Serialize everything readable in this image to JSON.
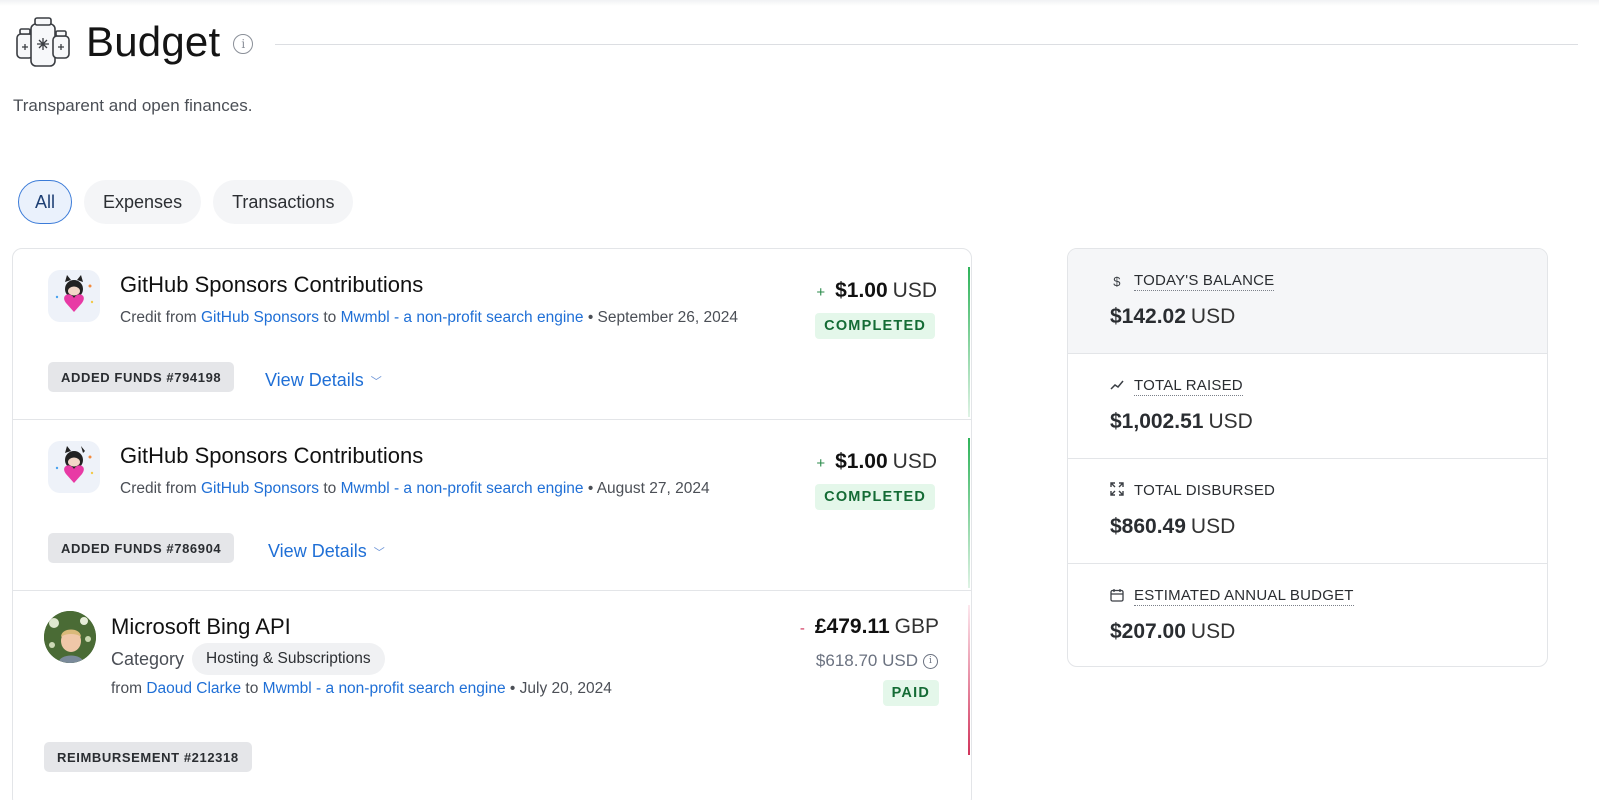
{
  "header": {
    "title": "Budget",
    "subtitle": "Transparent and open finances.",
    "info_glyph": "i"
  },
  "tabs": [
    {
      "label": "All",
      "active": true
    },
    {
      "label": "Expenses",
      "active": false
    },
    {
      "label": "Transactions",
      "active": false
    }
  ],
  "transactions": [
    {
      "title": "GitHub Sponsors Contributions",
      "prefix": "Credit from",
      "from": "GitHub Sponsors",
      "to_word": "to",
      "to": "Mwmbl - a non-profit search engine",
      "date": "• September 26, 2024",
      "sign": "+",
      "amount": "$1.00",
      "currency": "USD",
      "status": "COMPLETED",
      "badge": "ADDED FUNDS #794198",
      "details": "View Details",
      "icon": "github-sponsors-heart-icon"
    },
    {
      "title": "GitHub Sponsors Contributions",
      "prefix": "Credit from",
      "from": "GitHub Sponsors",
      "to_word": "to",
      "to": "Mwmbl - a non-profit search engine",
      "date": "• August 27, 2024",
      "sign": "+",
      "amount": "$1.00",
      "currency": "USD",
      "status": "COMPLETED",
      "badge": "ADDED FUNDS #786904",
      "details": "View Details",
      "icon": "github-sponsors-heart-icon"
    },
    {
      "title": "Microsoft Bing API",
      "category_label": "Category",
      "category": "Hosting & Subscriptions",
      "prefix": "from",
      "from": "Daoud Clarke",
      "to_word": "to",
      "to": "Mwmbl - a non-profit search engine",
      "date": "• July 20, 2024",
      "sign": "-",
      "amount": "£479.11",
      "currency": "GBP",
      "converted": "$618.70 USD",
      "status": "PAID",
      "badge": "REIMBURSEMENT #212318"
    }
  ],
  "summary": [
    {
      "label": "TODAY'S BALANCE",
      "amount": "$142.02",
      "currency": "USD",
      "icon": "dollar-icon"
    },
    {
      "label": "TOTAL RAISED",
      "amount": "$1,002.51",
      "currency": "USD",
      "icon": "trend-up-icon"
    },
    {
      "label": "TOTAL DISBURSED",
      "amount": "$860.49",
      "currency": "USD",
      "icon": "expand-arrows-icon"
    },
    {
      "label": "ESTIMATED ANNUAL BUDGET",
      "amount": "$207.00",
      "currency": "USD",
      "icon": "calendar-icon"
    }
  ],
  "colors": {
    "link": "#1f6fd6",
    "completed_bg": "#e4f7ea",
    "completed_text": "#146b35",
    "credit_edge": "#2fb35a",
    "debit_edge": "#d1345b",
    "tab_active_border": "#3b7bd8"
  }
}
